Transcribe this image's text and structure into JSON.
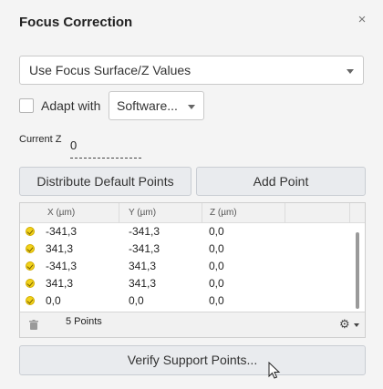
{
  "panel": {
    "title": "Focus Correction",
    "close_icon": "×"
  },
  "mode_select": {
    "value": "Use Focus Surface/Z Values"
  },
  "adapt": {
    "checked": false,
    "label": "Adapt with",
    "select_value": "Software..."
  },
  "current_z": {
    "label": "Current Z",
    "value": "0"
  },
  "buttons": {
    "distribute": "Distribute Default Points",
    "add": "Add Point",
    "verify": "Verify Support Points..."
  },
  "table": {
    "columns": [
      "X (µm)",
      "Y (µm)",
      "Z (µm)"
    ],
    "rows": [
      {
        "x": "-341,3",
        "y": "-341,3",
        "z": "0,0"
      },
      {
        "x": "341,3",
        "y": "-341,3",
        "z": "0,0"
      },
      {
        "x": "-341,3",
        "y": "341,3",
        "z": "0,0"
      },
      {
        "x": "341,3",
        "y": "341,3",
        "z": "0,0"
      },
      {
        "x": "0,0",
        "y": "0,0",
        "z": "0,0"
      }
    ],
    "footer_count": "5 Points"
  },
  "colors": {
    "background": "#f4f4f4",
    "button": "#e9ebee",
    "status_icon": "#f2d21a"
  },
  "icons": [
    "close-icon",
    "dropdown-caret-icon",
    "status-ok-icon",
    "trash-icon",
    "gear-icon",
    "mouse-pointer-icon"
  ]
}
